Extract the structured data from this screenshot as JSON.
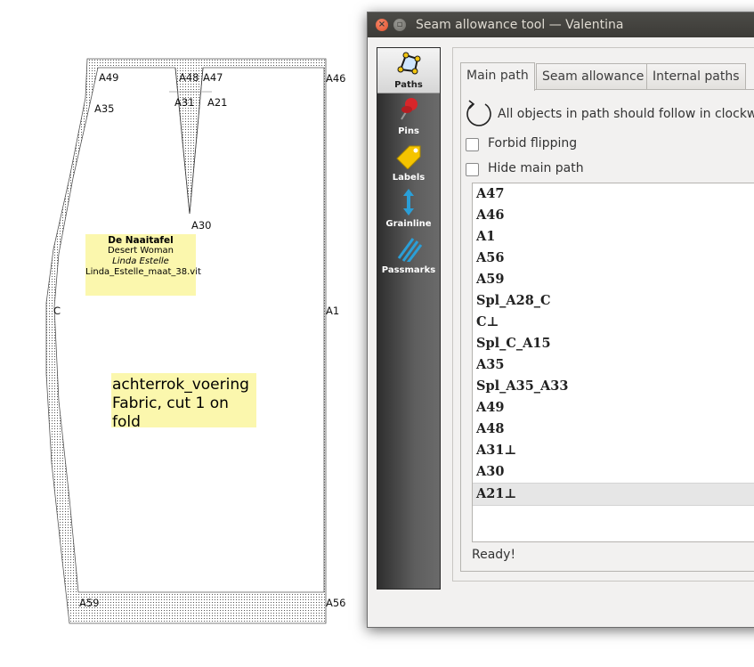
{
  "canvas": {
    "points": [
      "A49",
      "A48",
      "A47",
      "A46",
      "A35",
      "A31",
      "A21",
      "A30",
      "C",
      "A1",
      "A59",
      "A56"
    ],
    "label_small": {
      "line1": "De Naaitafel",
      "line2": "Desert Woman",
      "line3": "Linda Estelle",
      "line4": "Linda_Estelle_maat_38.vit"
    },
    "label_big": {
      "line1": "achterrok_voering",
      "line2": "Fabric, cut 1 on fold"
    }
  },
  "dialog": {
    "title": "Seam allowance tool — Valentina",
    "sidebar": [
      {
        "label": "Paths",
        "icon": "paths-icon"
      },
      {
        "label": "Pins",
        "icon": "pin-icon"
      },
      {
        "label": "Labels",
        "icon": "label-tag-icon"
      },
      {
        "label": "Grainline",
        "icon": "grainline-icon"
      },
      {
        "label": "Passmarks",
        "icon": "passmarks-icon"
      }
    ],
    "tabs": [
      "Main path",
      "Seam allowance",
      "Internal paths"
    ],
    "direction_text": "All objects in path should follow in clockw",
    "checkbox_forbid": "Forbid flipping",
    "checkbox_hide": "Hide main path",
    "path_items": [
      "A47",
      "A46",
      "A1",
      "A56",
      "A59",
      "Spl_A28_C",
      "C⊥",
      "Spl_C_A15",
      "A35",
      "Spl_A35_A33",
      "A49",
      "A48",
      "A31⊥",
      "A30",
      "A21⊥"
    ],
    "selected_item": "A21⊥",
    "status": "Ready!"
  },
  "colors": {
    "label_bg": "#fbf7ad",
    "titlebar": "#3c3b37",
    "close": "#e2512b",
    "sidebar_dark": "#2e2e2e",
    "accent_blue": "#2a9fd8"
  }
}
